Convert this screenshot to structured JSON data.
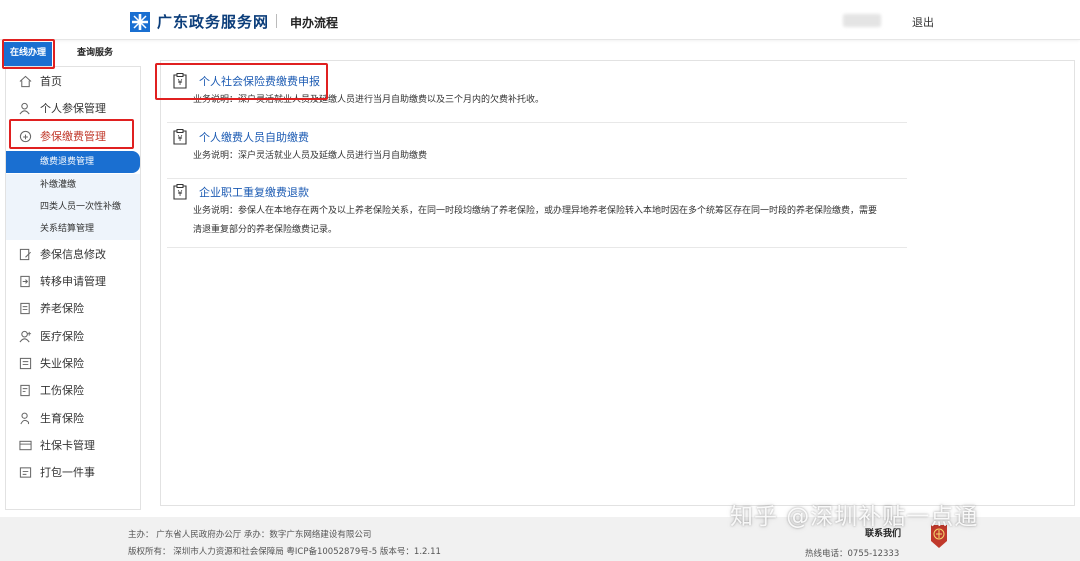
{
  "header": {
    "site_title": "广东政务服务网",
    "section": "申办流程",
    "logout": "退出"
  },
  "tabs": [
    {
      "label": "在线办理",
      "active": true
    },
    {
      "label": "查询服务",
      "active": false
    }
  ],
  "sidebar": {
    "items": [
      {
        "label": "首页",
        "icon": "home-icon"
      },
      {
        "label": "个人参保管理",
        "icon": "person-icon"
      },
      {
        "label": "参保缴费管理",
        "icon": "payment-icon"
      },
      {
        "label": "参保信息修改",
        "icon": "edit-icon"
      },
      {
        "label": "转移申请管理",
        "icon": "transfer-icon"
      },
      {
        "label": "养老保险",
        "icon": "document-icon"
      },
      {
        "label": "医疗保险",
        "icon": "medical-icon"
      },
      {
        "label": "失业保险",
        "icon": "unemployment-icon"
      },
      {
        "label": "工伤保险",
        "icon": "injury-icon"
      },
      {
        "label": "生育保险",
        "icon": "maternity-icon"
      },
      {
        "label": "社保卡管理",
        "icon": "card-icon"
      },
      {
        "label": "打包一件事",
        "icon": "package-icon"
      }
    ],
    "subitems": [
      {
        "label": "缴费退费管理",
        "active": true
      },
      {
        "label": "补缴灌缴",
        "active": false
      },
      {
        "label": "四类人员一次性补缴",
        "active": false
      },
      {
        "label": "关系结算管理",
        "active": false
      }
    ]
  },
  "services": [
    {
      "title": "个人社会保险费缴费申报",
      "desc": "业务说明：深户灵活就业人员及延缴人员进行当月自助缴费以及三个月内的欠费补托收。"
    },
    {
      "title": "个人缴费人员自助缴费",
      "desc": "业务说明：深户灵活就业人员及延缴人员进行当月自助缴费"
    },
    {
      "title": "企业职工重复缴费退款",
      "desc": "业务说明：参保人在本地存在两个及以上养老保险关系，在同一时段均缴纳了养老保险，或办理异地养老保险转入本地时因在多个统筹区存在同一时段的养老保险缴费，需要清退重复部分的养老保险缴费记录。"
    }
  ],
  "footer": {
    "line1": "主办：  广东省人民政府办公厅    承办：数字广东网络建设有限公司",
    "line2": "版权所有：  深圳市人力资源和社会保障局    粤ICP备10052879号-5    版本号：1.2.11",
    "contact": "联系我们",
    "hotline": "热线电话：0755-12333"
  },
  "watermark": "知乎 @深圳补贴一点通",
  "colors": {
    "accent": "#1a6fd1",
    "highlight": "#e02020",
    "link": "#1c5bb3"
  }
}
